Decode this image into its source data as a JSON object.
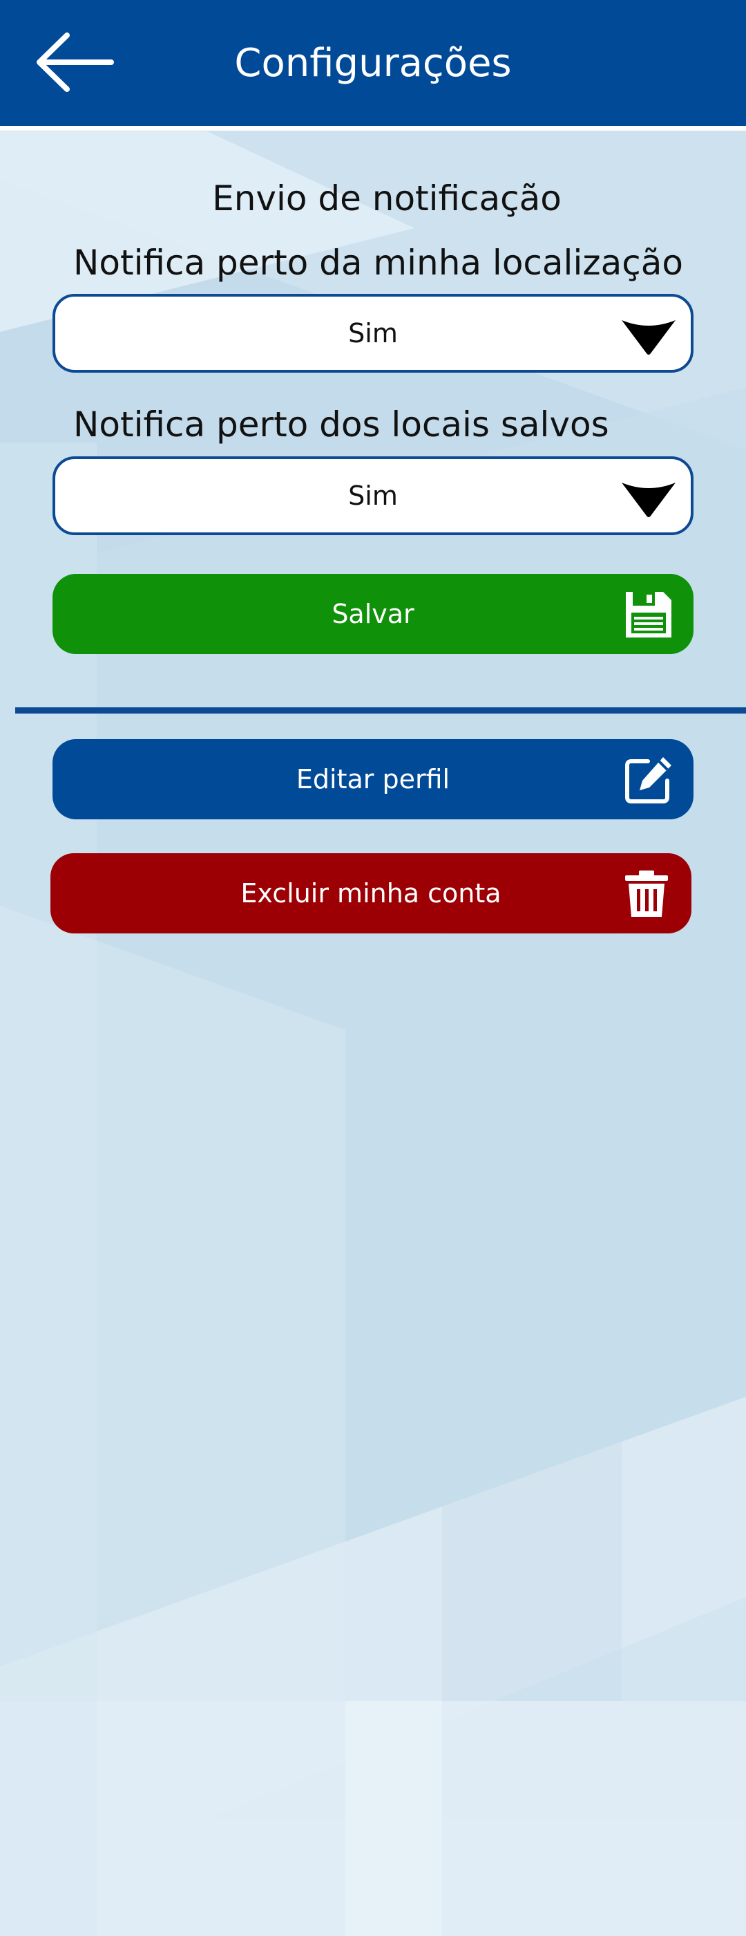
{
  "header": {
    "title": "Configurações",
    "back_icon": "arrow-left-icon",
    "background_color": "#014a98"
  },
  "notifications": {
    "section_title": "Envio de notificação",
    "near_location": {
      "label": "Notifica perto da minha localização",
      "value": "Sim"
    },
    "near_saved_places": {
      "label": "Notifica perto dos locais salvos",
      "value": "Sim"
    },
    "save_button": {
      "label": "Salvar",
      "icon": "floppy-disk-icon",
      "color": "#0f9109"
    }
  },
  "account": {
    "edit_profile_button": {
      "label": "Editar perfil",
      "icon": "edit-icon",
      "color": "#014a98"
    },
    "delete_account_button": {
      "label": "Excluir minha conta",
      "icon": "trash-icon",
      "color": "#9c0004"
    }
  }
}
